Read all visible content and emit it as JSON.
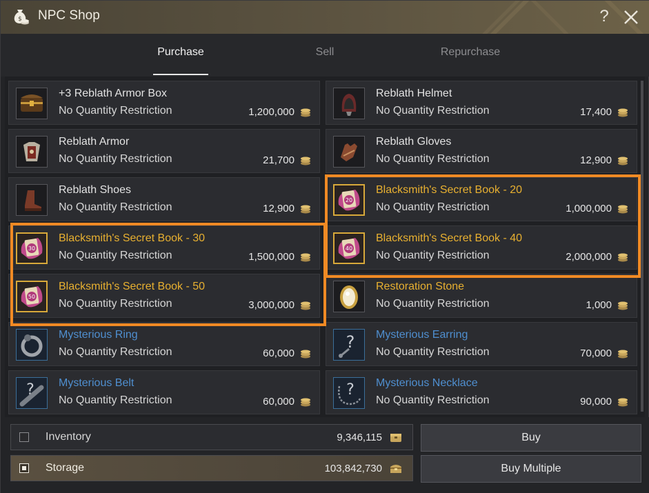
{
  "window": {
    "title": "NPC Shop",
    "help_label": "?"
  },
  "tabs": [
    {
      "label": "Purchase",
      "active": true
    },
    {
      "label": "Sell",
      "active": false
    },
    {
      "label": "Repurchase",
      "active": false
    }
  ],
  "items": [
    {
      "name": "+3 Reblath Armor Box",
      "restriction": "No Quantity Restriction",
      "price": "1,200,000",
      "grade": "white",
      "icon": "armor-box-icon"
    },
    {
      "name": "Reblath Helmet",
      "restriction": "No Quantity Restriction",
      "price": "17,400",
      "grade": "white",
      "icon": "helmet-icon"
    },
    {
      "name": "Reblath Armor",
      "restriction": "No Quantity Restriction",
      "price": "21,700",
      "grade": "white",
      "icon": "armor-icon"
    },
    {
      "name": "Reblath Gloves",
      "restriction": "No Quantity Restriction",
      "price": "12,900",
      "grade": "white",
      "icon": "gloves-icon"
    },
    {
      "name": "Reblath Shoes",
      "restriction": "No Quantity Restriction",
      "price": "12,900",
      "grade": "white",
      "icon": "shoes-icon"
    },
    {
      "name": "Blacksmith's Secret Book - 20",
      "restriction": "No Quantity Restriction",
      "price": "1,000,000",
      "grade": "gold",
      "icon": "secret-book-icon",
      "badge": "20"
    },
    {
      "name": "Blacksmith's Secret Book - 30",
      "restriction": "No Quantity Restriction",
      "price": "1,500,000",
      "grade": "gold",
      "icon": "secret-book-icon",
      "badge": "30"
    },
    {
      "name": "Blacksmith's Secret Book - 40",
      "restriction": "No Quantity Restriction",
      "price": "2,000,000",
      "grade": "gold",
      "icon": "secret-book-icon",
      "badge": "40"
    },
    {
      "name": "Blacksmith's Secret Book - 50",
      "restriction": "No Quantity Restriction",
      "price": "3,000,000",
      "grade": "gold",
      "icon": "secret-book-icon",
      "badge": "50"
    },
    {
      "name": "Restoration Stone",
      "restriction": "No Quantity Restriction",
      "price": "1,000",
      "grade": "gold",
      "icon": "restoration-stone-icon"
    },
    {
      "name": "Mysterious Ring",
      "restriction": "No Quantity Restriction",
      "price": "60,000",
      "grade": "blue",
      "icon": "ring-icon"
    },
    {
      "name": "Mysterious Earring",
      "restriction": "No Quantity Restriction",
      "price": "70,000",
      "grade": "blue",
      "icon": "earring-icon"
    },
    {
      "name": "Mysterious Belt",
      "restriction": "No Quantity Restriction",
      "price": "60,000",
      "grade": "blue",
      "icon": "belt-icon"
    },
    {
      "name": "Mysterious Necklace",
      "restriction": "No Quantity Restriction",
      "price": "90,000",
      "grade": "blue",
      "icon": "necklace-icon"
    }
  ],
  "money": {
    "inventory_label": "Inventory",
    "inventory_value": "9,346,115",
    "inventory_checked": false,
    "storage_label": "Storage",
    "storage_value": "103,842,730",
    "storage_checked": true
  },
  "buttons": {
    "buy": "Buy",
    "buy_multiple": "Buy Multiple"
  },
  "colors": {
    "highlight": "#f08a24",
    "gold_text": "#e8b030",
    "blue_text": "#4f8fd0"
  }
}
